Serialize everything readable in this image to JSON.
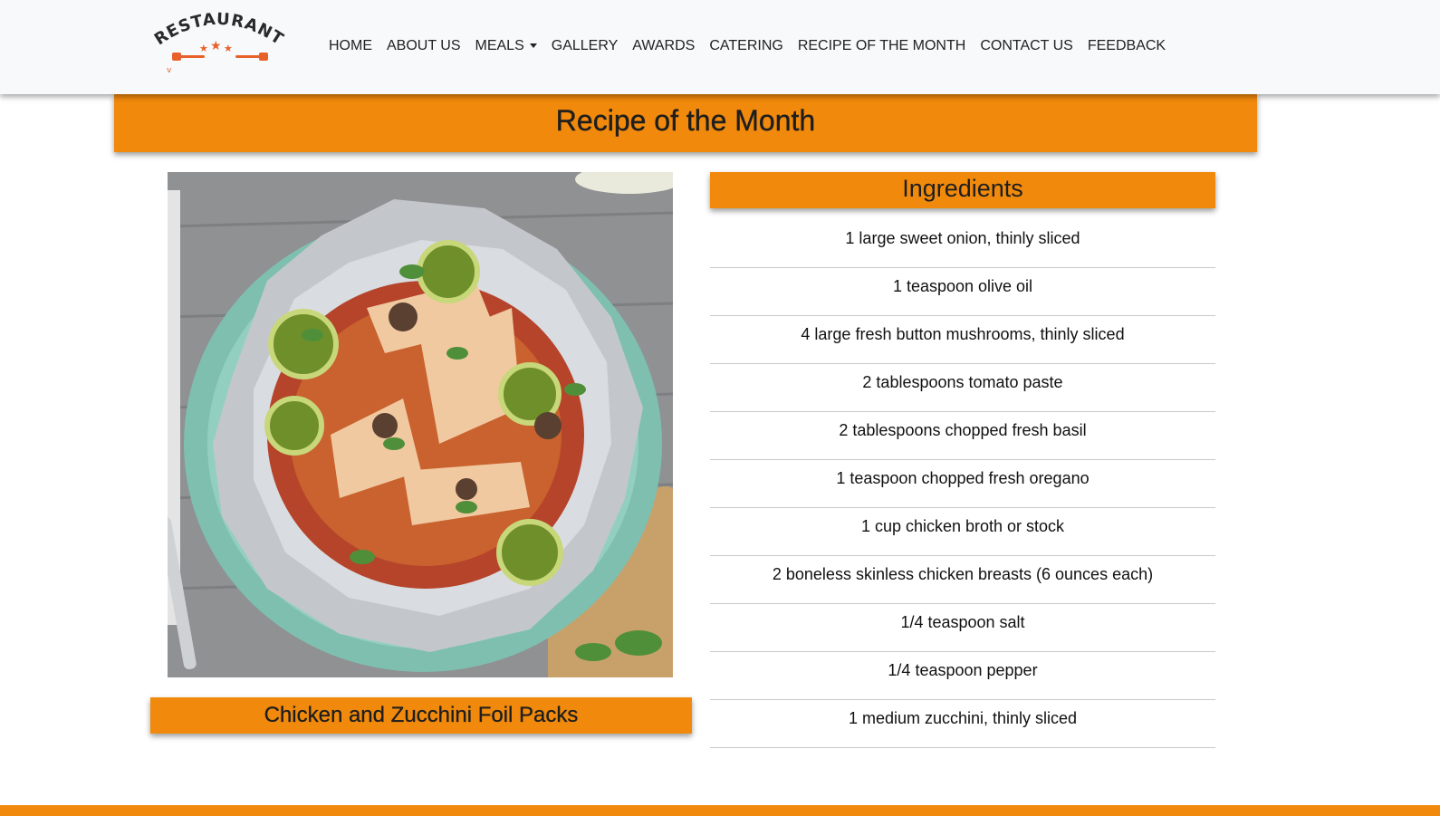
{
  "brand": {
    "logo_text": "RESTAURANT",
    "logo_mark": "v",
    "colors": {
      "accent": "#f18a0c",
      "logo_text": "#2a2a2a",
      "logo_stars": "#e8602a"
    }
  },
  "nav": {
    "items": [
      {
        "label": "HOME"
      },
      {
        "label": "ABOUT US"
      },
      {
        "label": "MEALS",
        "dropdown": true
      },
      {
        "label": "GALLERY"
      },
      {
        "label": "AWARDS"
      },
      {
        "label": "CATERING"
      },
      {
        "label": "RECIPE OF THE MONTH"
      },
      {
        "label": "CONTACT US"
      },
      {
        "label": "FEEDBACK"
      }
    ]
  },
  "page": {
    "title": "Recipe of the Month"
  },
  "recipe": {
    "name": "Chicken and Zucchini Foil Packs",
    "image_icon": "food-photo"
  },
  "ingredients": {
    "header": "Ingredients",
    "items": [
      "1 large sweet onion, thinly sliced",
      "1 teaspoon olive oil",
      "4 large fresh button mushrooms, thinly sliced",
      "2 tablespoons tomato paste",
      "2 tablespoons chopped fresh basil",
      "1 teaspoon chopped fresh oregano",
      "1 cup chicken broth or stock",
      "2 boneless skinless chicken breasts (6 ounces each)",
      "1/4 teaspoon salt",
      "1/4 teaspoon pepper",
      "1 medium zucchini, thinly sliced"
    ]
  }
}
